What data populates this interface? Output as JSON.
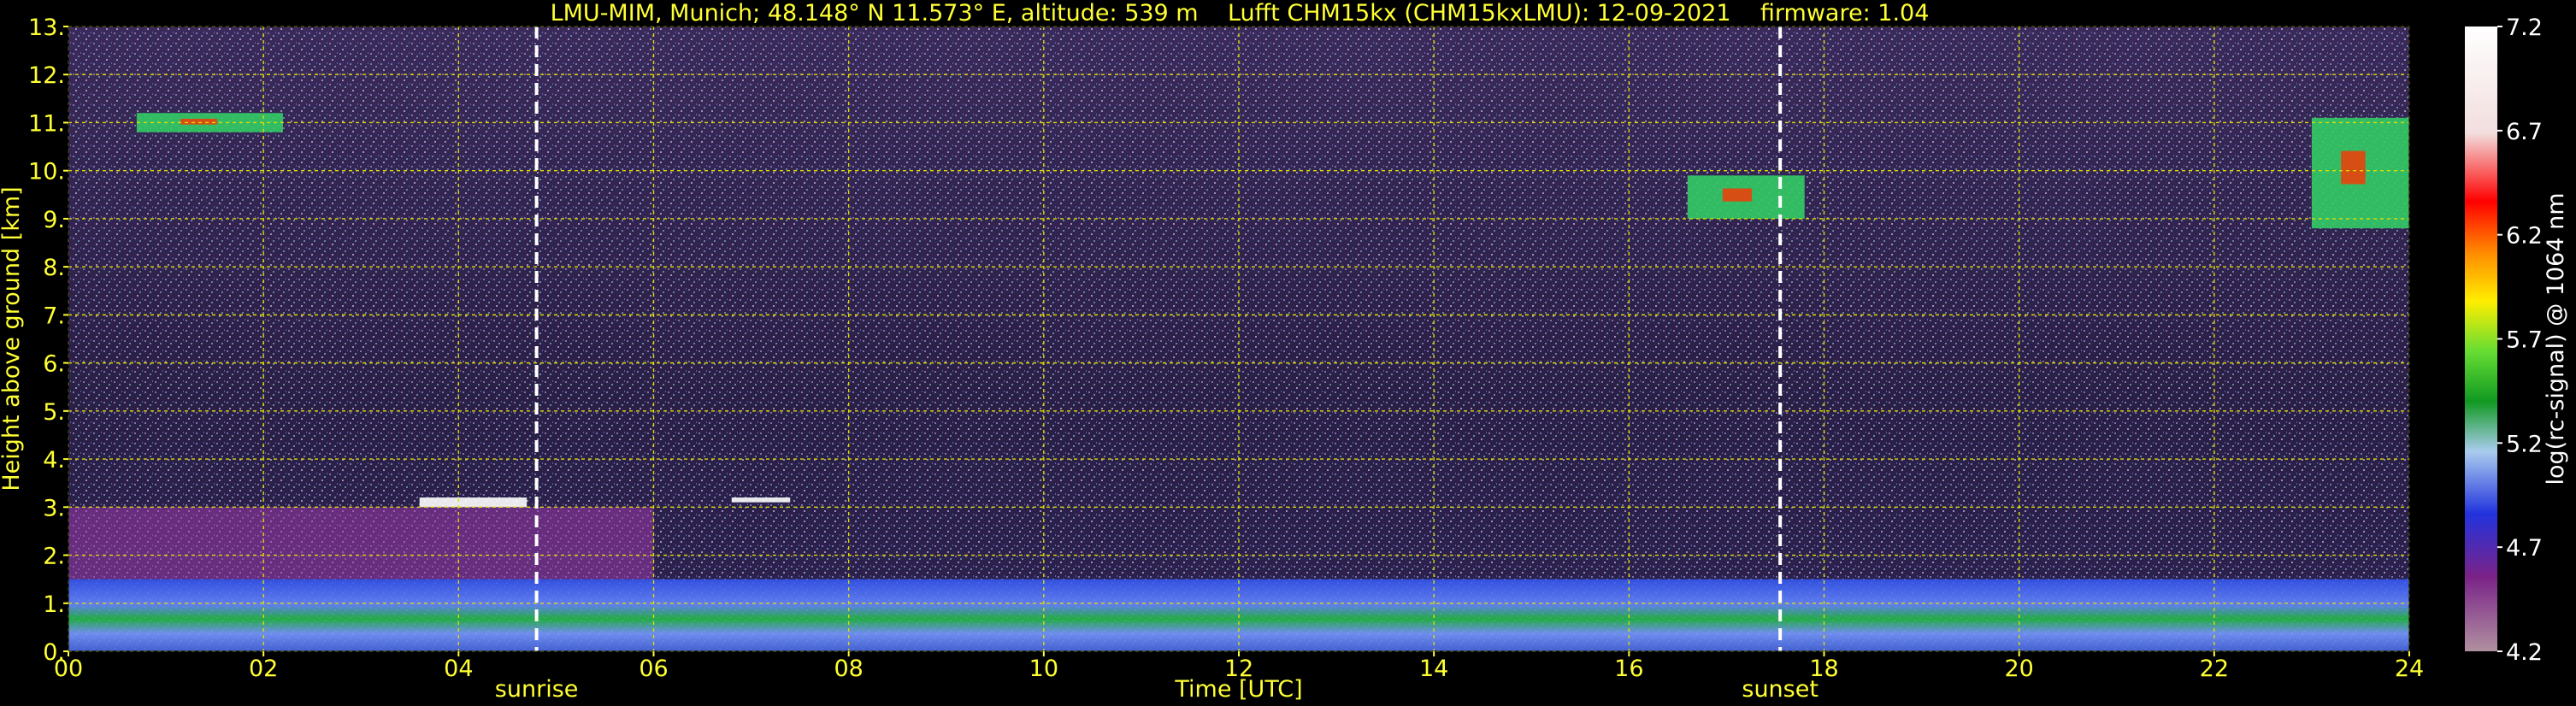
{
  "chart_data": {
    "type": "heatmap",
    "title": "LMU-MIM, Munich; 48.148° N 11.573° E, altitude: 539 m    Lufft CHM15kx (CHM15kxLMU): 12-09-2021    firmware: 1.04",
    "xlabel": "Time [UTC]",
    "ylabel": "Height above ground [km]",
    "xlim": [
      0,
      24
    ],
    "ylim": [
      0,
      13
    ],
    "x_ticks": [
      "00",
      "02",
      "04",
      "06",
      "08",
      "10",
      "12",
      "14",
      "16",
      "18",
      "20",
      "22",
      "24"
    ],
    "y_ticks": [
      "0.",
      "1.",
      "2.",
      "3.",
      "4.",
      "5.",
      "6.",
      "7.",
      "8.",
      "9.",
      "10.",
      "11.",
      "12.",
      "13."
    ],
    "grid": true,
    "markers": [
      {
        "label": "sunrise",
        "x": 4.8
      },
      {
        "label": "sunset",
        "x": 17.55
      }
    ],
    "colorbar": {
      "label": "log(rc-signal) @ 1064 nm",
      "range": [
        4.2,
        7.2
      ],
      "ticks": [
        "7.2",
        "6.7",
        "6.2",
        "5.7",
        "5.2",
        "4.7",
        "4.2"
      ]
    },
    "features": [
      {
        "name": "boundary layer aerosol",
        "x": [
          0,
          24
        ],
        "y": [
          0,
          1.5
        ]
      },
      {
        "name": "residual layer",
        "x": [
          0,
          6
        ],
        "y": [
          1.5,
          3.0
        ]
      },
      {
        "name": "cloud",
        "x": [
          3.6,
          4.7
        ],
        "y": [
          3.0,
          3.2
        ]
      },
      {
        "name": "cloud",
        "x": [
          6.8,
          7.4
        ],
        "y": [
          3.1,
          3.2
        ]
      },
      {
        "name": "cirrus",
        "x": [
          0.7,
          2.2
        ],
        "y": [
          10.8,
          11.2
        ]
      },
      {
        "name": "cirrus",
        "x": [
          16.6,
          17.8
        ],
        "y": [
          9.0,
          9.9
        ]
      },
      {
        "name": "cirrus",
        "x": [
          23.0,
          24
        ],
        "y": [
          8.8,
          11.1
        ]
      }
    ]
  }
}
